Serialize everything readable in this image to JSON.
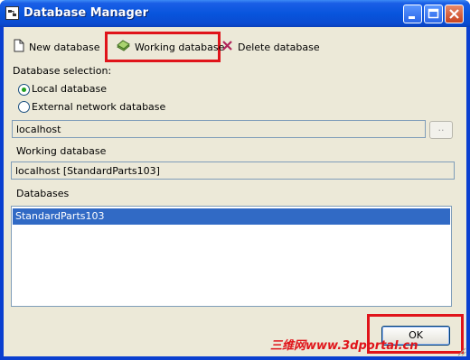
{
  "window": {
    "title": "Database Manager"
  },
  "toolbar": {
    "new_label": "New database",
    "working_label": "Working database",
    "delete_label": "Delete database"
  },
  "selection": {
    "label": "Database selection:",
    "options": [
      {
        "label": "Local database",
        "selected": true
      },
      {
        "label": "External network database",
        "selected": false
      }
    ],
    "host_value": "localhost",
    "browse_label": ".."
  },
  "working": {
    "label": "Working database",
    "value": "localhost [StandardParts103]"
  },
  "databases": {
    "label": "Databases",
    "items": [
      "StandardParts103"
    ]
  },
  "footer": {
    "ok_label": "OK"
  },
  "watermark": {
    "text": "三维网www.3dportal.cn"
  },
  "colors": {
    "highlight_box": "#e0141a",
    "selection": "#316ac5",
    "titlebar": "#0855dd"
  }
}
